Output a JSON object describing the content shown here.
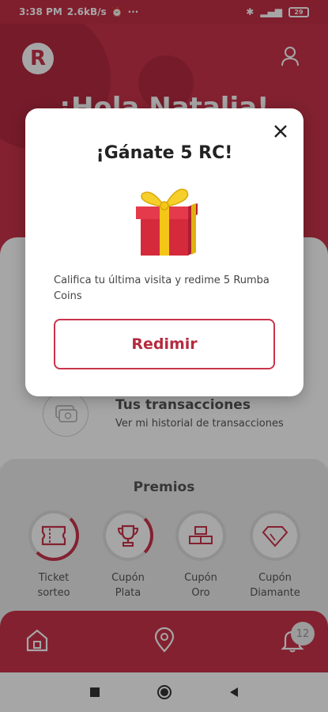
{
  "status_bar": {
    "time": "3:38 PM",
    "speed": "2.6kB/s",
    "battery": "29"
  },
  "hero": {
    "greeting": "¡Hola Natalia!",
    "logo_letter": "R"
  },
  "transactions": {
    "title": "Tus transacciones",
    "subtitle": "Ver mi historial de transacciones"
  },
  "prizes": {
    "title": "Premios",
    "items": [
      {
        "label_line1": "Ticket",
        "label_line2": "sorteo",
        "progress": 0.55
      },
      {
        "label_line1": "Cupón",
        "label_line2": "Plata",
        "progress": 0.3
      },
      {
        "label_line1": "Cupón",
        "label_line2": "Oro",
        "progress": 0.15
      },
      {
        "label_line1": "Cupón",
        "label_line2": "Diamante",
        "progress": 0.05
      }
    ]
  },
  "bottom_nav": {
    "notification_count": "12"
  },
  "modal": {
    "title": "¡Gánate 5 RC!",
    "description": "Califica tu última visita y redime 5 Rumba Coins",
    "button_label": "Redimir"
  },
  "colors": {
    "accent": "#c9344b",
    "accent_dark": "#b52a3f"
  }
}
